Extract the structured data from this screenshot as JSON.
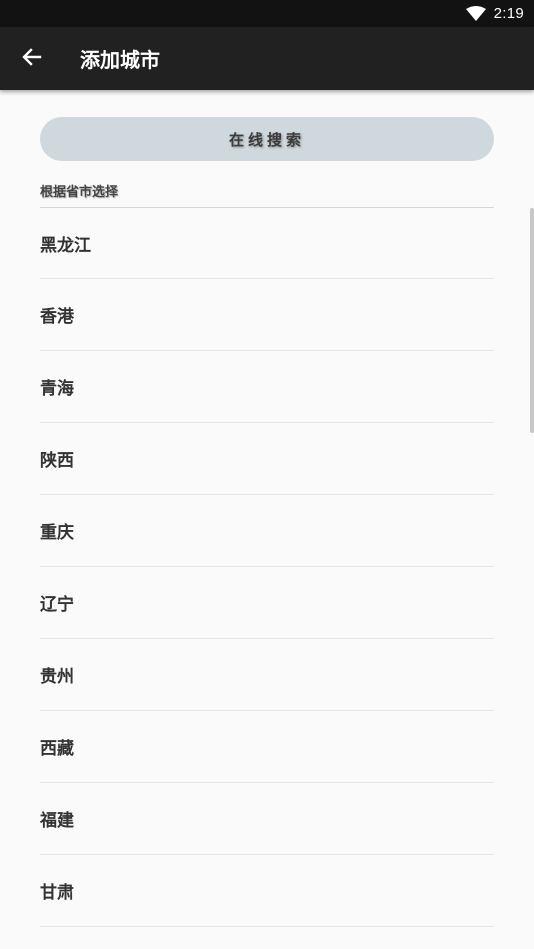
{
  "status_bar": {
    "time": "2:19",
    "wifi_icon": "wifi-icon"
  },
  "app_bar": {
    "title": "添加城市",
    "back_icon": "arrow-left-icon"
  },
  "search": {
    "label": "在线搜索"
  },
  "section": {
    "header": "根据省市选择"
  },
  "provinces": [
    "黑龙江",
    "香港",
    "青海",
    "陕西",
    "重庆",
    "辽宁",
    "贵州",
    "西藏",
    "福建",
    "甘肃"
  ],
  "colors": {
    "status_bar_bg": "#121212",
    "app_bar_bg": "#212121",
    "search_button_bg": "#cfd8dc",
    "page_bg": "#fafafa"
  }
}
